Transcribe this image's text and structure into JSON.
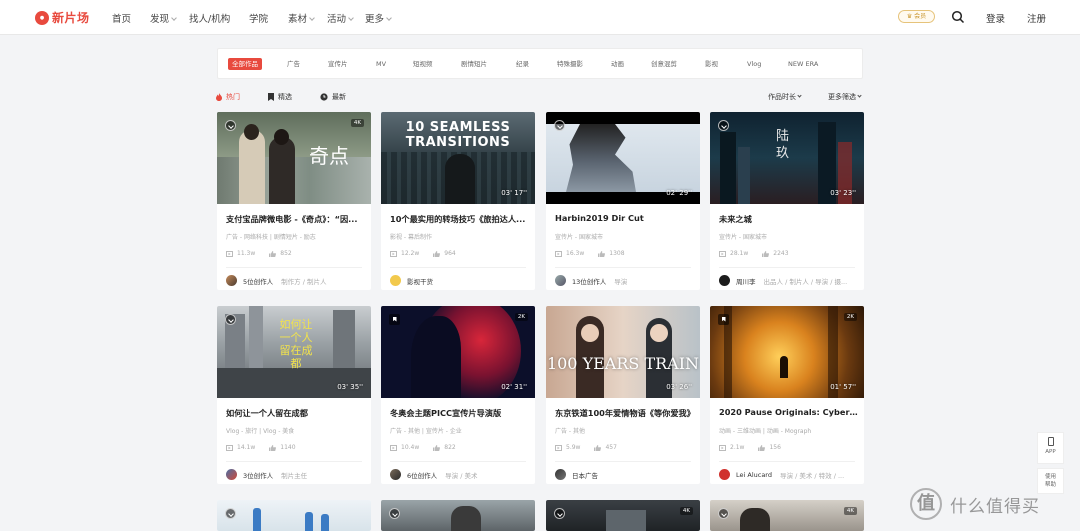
{
  "nav": {
    "logo_mark": "新片场",
    "logo_text": "新片场",
    "items": [
      "首页",
      "发现",
      "找人/机构",
      "学院",
      "素材",
      "活动",
      "更多"
    ],
    "vip_label": "会员",
    "login": "登录",
    "register": "注册"
  },
  "filters": [
    "全部作品",
    "广告",
    "宣传片",
    "MV",
    "短视频",
    "剧情短片",
    "纪录",
    "特殊摄影",
    "动画",
    "创意混剪",
    "影视",
    "Vlog",
    "NEW ERA"
  ],
  "sort": {
    "hot": "热门",
    "picked": "精选",
    "latest": "最新",
    "duration": "作品时长",
    "more": "更多筛选"
  },
  "cards": [
    {
      "title": "支付宝品牌微电影 -《奇点》：“因...",
      "tags": "广告 - 网络科技  |  剧情短片 - 励志",
      "views": "11.3w",
      "likes": "852",
      "author": "5位创作人",
      "role": "制作方 / 制片人",
      "res": "4K",
      "duration": "",
      "overlay": "奇点"
    },
    {
      "title": "10个最实用的转场技巧《旅拍达人...",
      "tags": "影视 - 幕后制作",
      "views": "12.2w",
      "likes": "964",
      "author": "影视干货",
      "role": "",
      "res": "",
      "duration": "03' 17''",
      "overlay": "10 SEAMLESS TRANSITIONS"
    },
    {
      "title": "Harbin2019 Dir Cut",
      "tags": "宣传片 - 国家城市",
      "views": "16.3w",
      "likes": "1308",
      "author": "13位创作人",
      "role": "导演",
      "res": "",
      "duration": "02' 29''",
      "overlay": ""
    },
    {
      "title": "未来之城",
      "tags": "宣传片 - 国家城市",
      "views": "28.1w",
      "likes": "2243",
      "author": "周川李",
      "role": "出品人 / 制片人 / 导演 / 摄...",
      "res": "",
      "duration": "03' 23''",
      "overlay": "陆玖"
    },
    {
      "title": "如何让一个人留在成都",
      "tags": "Vlog - 旅行  |  Vlog - 美食",
      "views": "14.1w",
      "likes": "1140",
      "author": "3位创作人",
      "role": "制片主任",
      "res": "",
      "duration": "03' 35''",
      "overlay": "如何让一个人留在成都"
    },
    {
      "title": "冬奥会主题PICC宣传片导演版",
      "tags": "广告 - 其他  |  宣传片 - 企业",
      "views": "10.4w",
      "likes": "822",
      "author": "6位创作人",
      "role": "导演 / 美术",
      "res": "2K",
      "duration": "02' 31''",
      "overlay": ""
    },
    {
      "title": "东京铁道100年爱情物语《等你爱我》",
      "tags": "广告 - 其他",
      "views": "5.9w",
      "likes": "457",
      "author": "日本广告",
      "role": "",
      "res": "",
      "duration": "03' 26''",
      "overlay": "100 YEARS TRAIN"
    },
    {
      "title": "2020 Pause Originals: Cyberpun...",
      "tags": "动画 - 三维动画  |  动画 - Mograph",
      "views": "2.1w",
      "likes": "156",
      "author": "Lei Alucard",
      "role": "导演 / 美术 / 特效 / ...",
      "res": "2K",
      "duration": "01' 57''",
      "overlay": ""
    }
  ],
  "bottom_row_res": [
    "",
    "",
    "4K",
    "4K"
  ],
  "float": {
    "app": "APP",
    "help": "使用帮助"
  },
  "watermark": {
    "logo": "值",
    "text": "什么值得买"
  }
}
